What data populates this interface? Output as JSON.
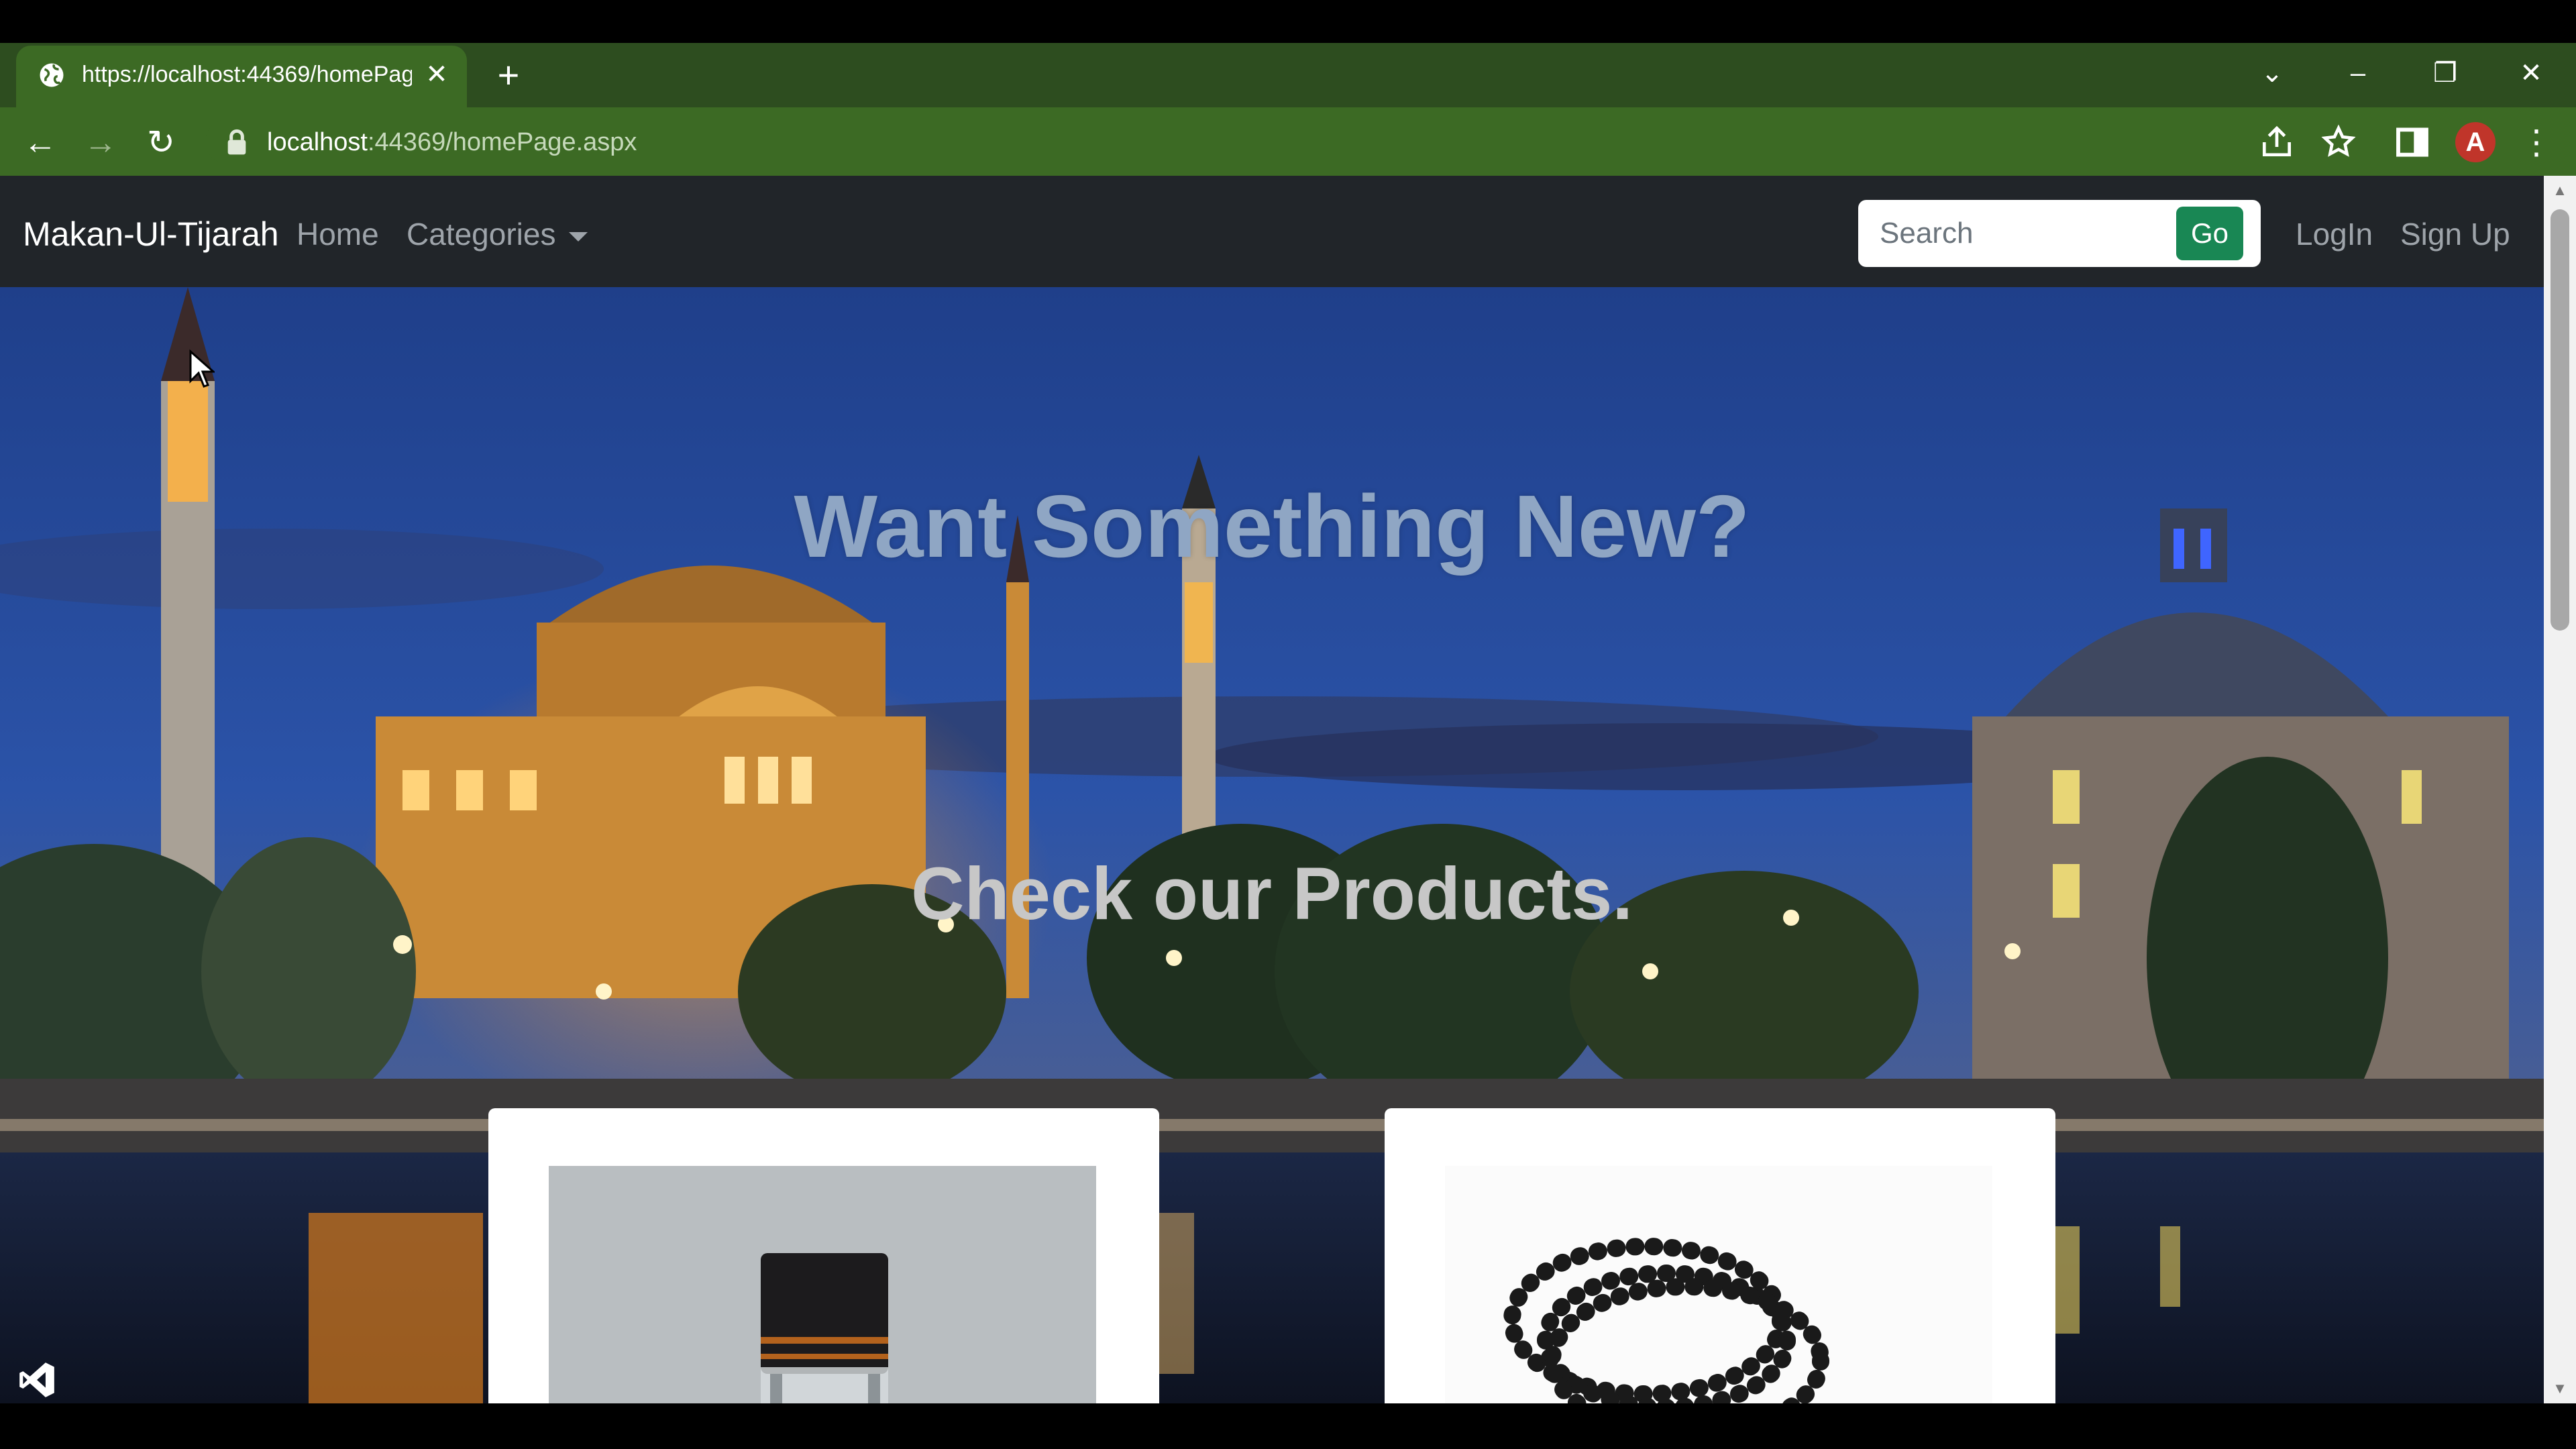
{
  "browser": {
    "tab": {
      "title": "https://localhost:44369/homePage.aspx",
      "close": "✕"
    },
    "new_tab": "+",
    "window_controls": {
      "tab_search": "⌄",
      "minimize": "–",
      "restore": "❐",
      "close": "✕"
    },
    "nav": {
      "back": "←",
      "forward": "→",
      "reload": "↻"
    },
    "address": {
      "host": "localhost",
      "path": ":44369/homePage.aspx"
    },
    "profile_initial": "A",
    "menu": "⋮"
  },
  "site": {
    "brand": "Makan-Ul-Tijarah",
    "nav": {
      "home": "Home",
      "categories": "Categories",
      "login": "LogIn",
      "signup": "Sign Up"
    },
    "search": {
      "placeholder": "Search",
      "value": "",
      "button": "Go"
    }
  },
  "hero": {
    "title": "Want Something New?",
    "subtitle": "Check our Products."
  },
  "colors": {
    "tabstrip": "#2d4d1f",
    "toolbar": "#3c6a24",
    "navbar": "#212529",
    "go_button": "#198754"
  },
  "icons": [
    "globe-icon",
    "lock-icon",
    "share-icon",
    "star-icon",
    "sidebar-icon",
    "visual-studio-icon",
    "mouse-cursor-icon"
  ]
}
